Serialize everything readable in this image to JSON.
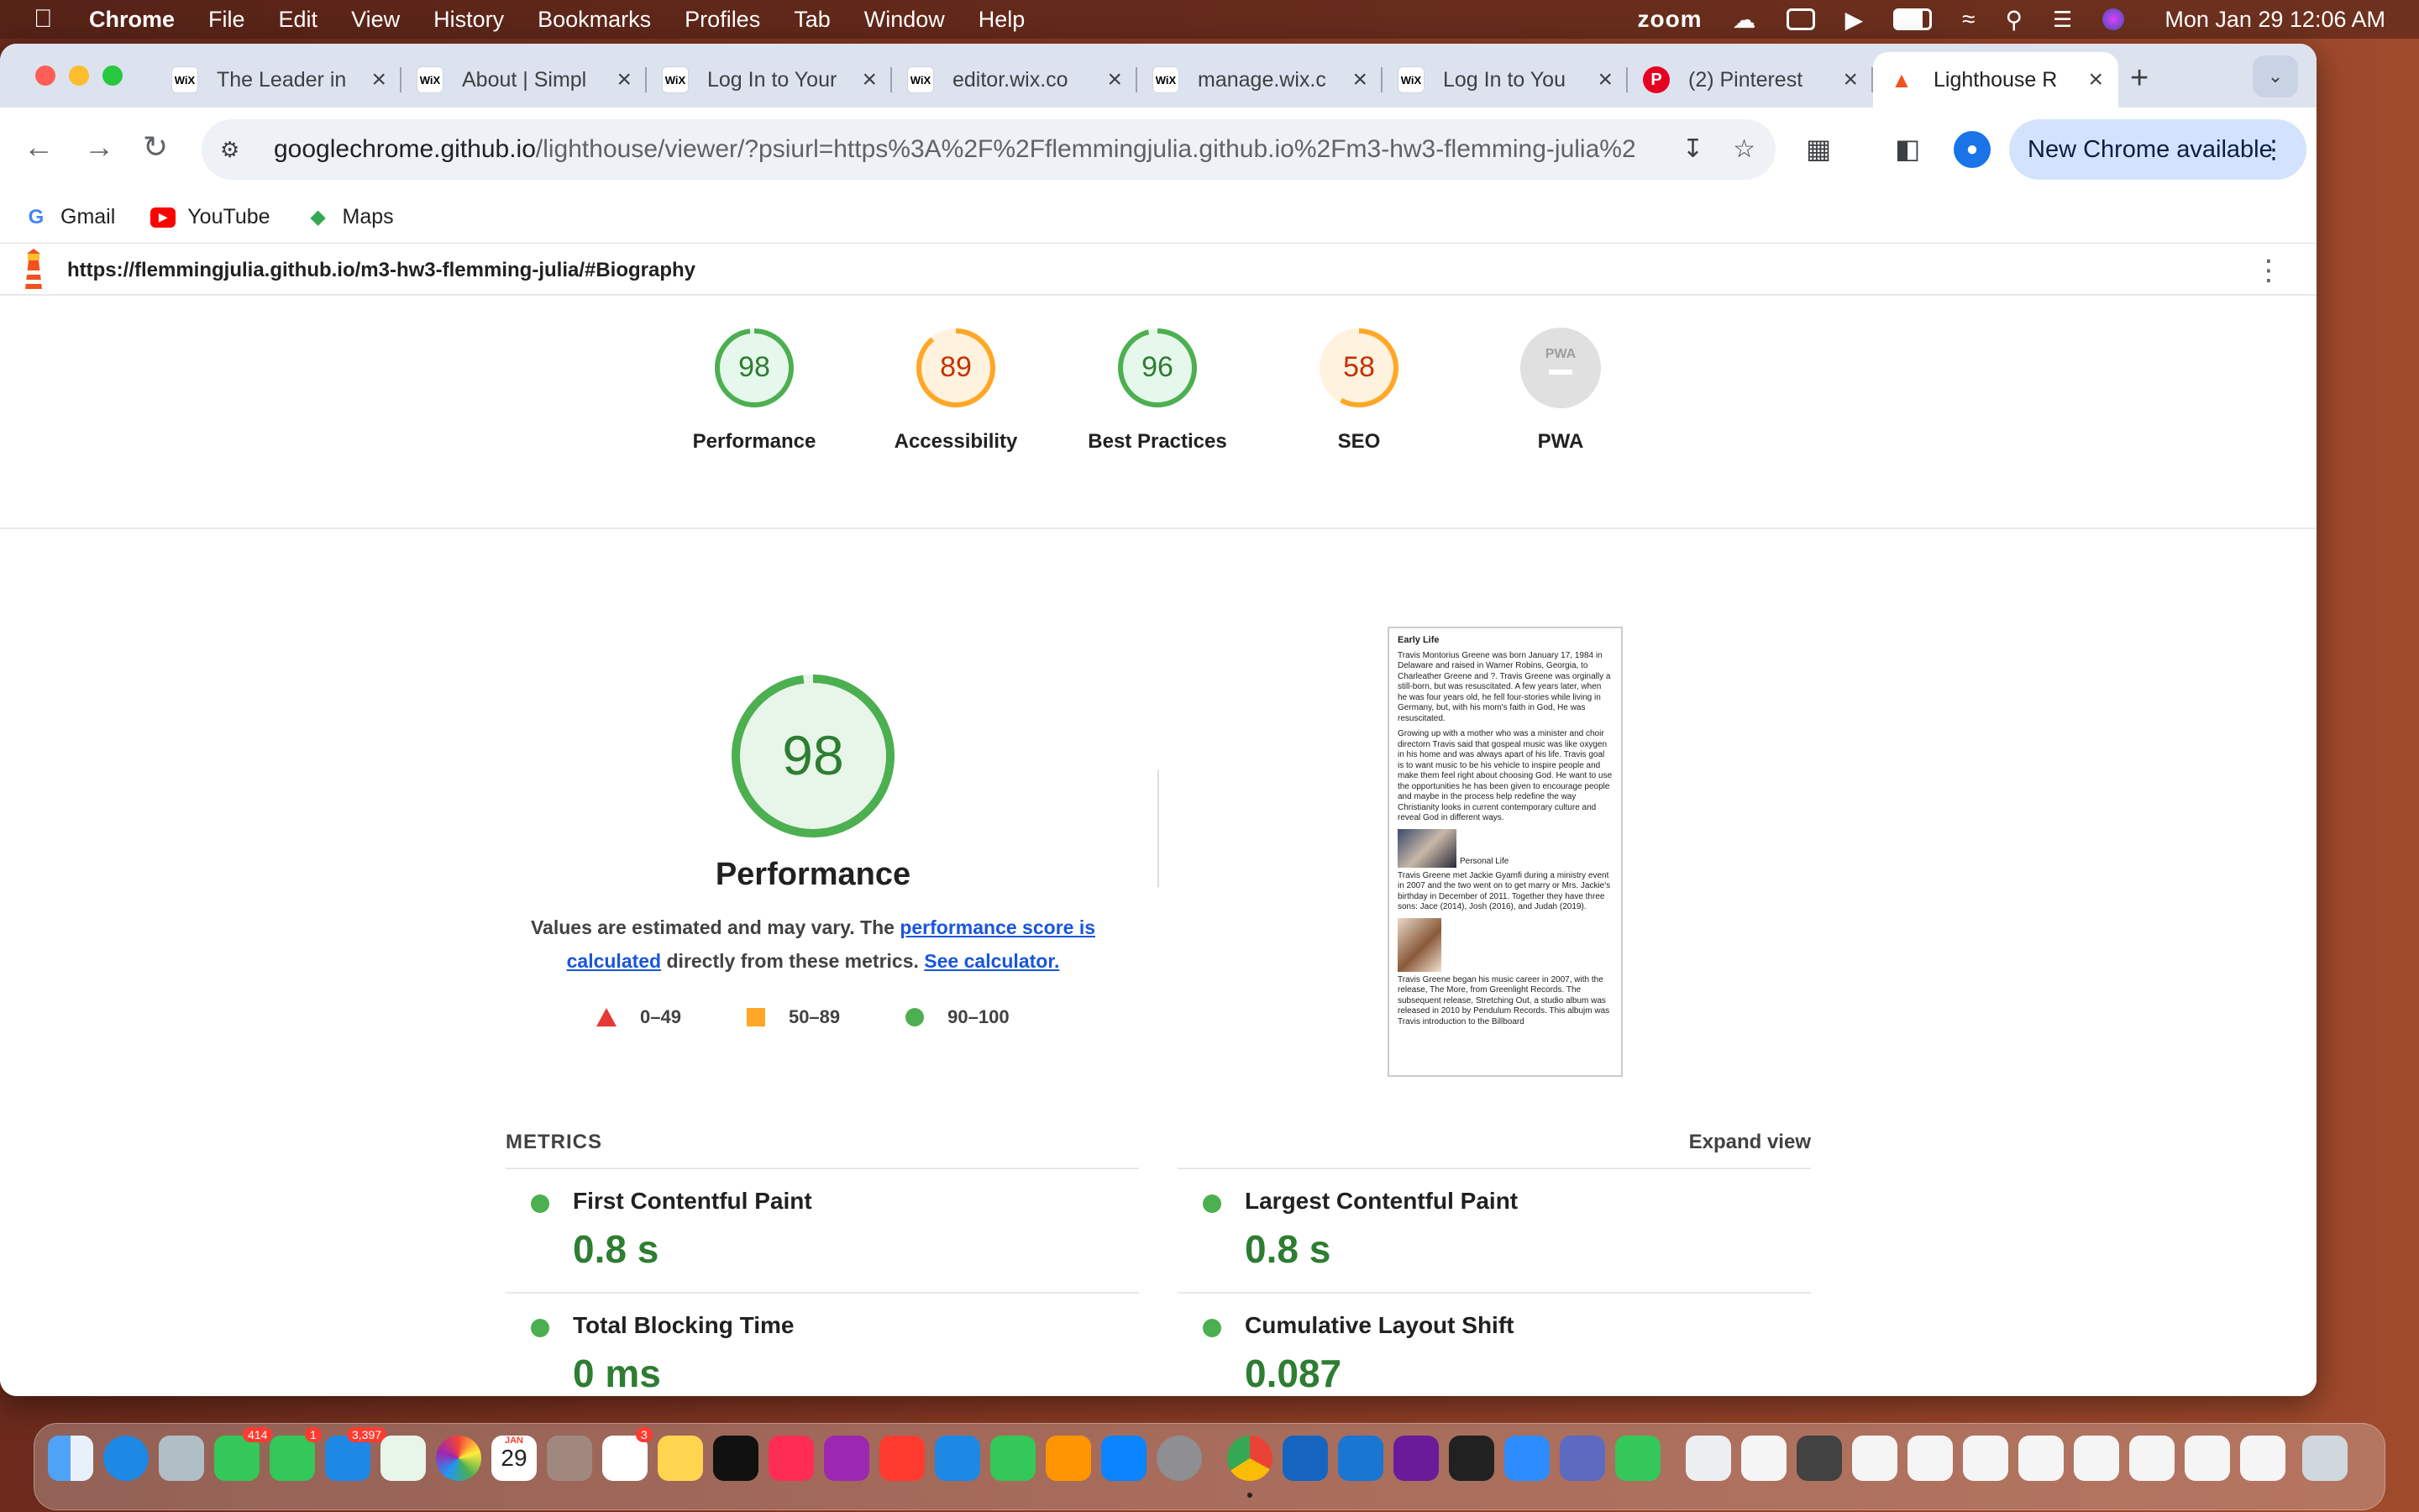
{
  "menubar": {
    "app": "Chrome",
    "items": [
      "File",
      "Edit",
      "View",
      "History",
      "Bookmarks",
      "Profiles",
      "Tab",
      "Window",
      "Help"
    ],
    "zoom": "zoom",
    "clock": "Mon Jan 29  12:06 AM"
  },
  "tabs": [
    {
      "title": "The Leader in",
      "icon": "wix"
    },
    {
      "title": "About | Simpl",
      "icon": "wix"
    },
    {
      "title": "Log In to Your",
      "icon": "wix"
    },
    {
      "title": "editor.wix.co",
      "icon": "wix"
    },
    {
      "title": "manage.wix.c",
      "icon": "wix"
    },
    {
      "title": "Log In to You",
      "icon": "wix"
    },
    {
      "title": "(2) Pinterest",
      "icon": "pinterest"
    },
    {
      "title": "Lighthouse R",
      "icon": "lighthouse"
    }
  ],
  "toolbar": {
    "url_host": "googlechrome.github.io",
    "url_rest": "/lighthouse/viewer/?psiurl=https%3A%2F%2Fflemmingjulia.github.io%2Fm3-hw3-flemming-julia%2...",
    "new_chrome": "New Chrome available"
  },
  "bookmarks": [
    {
      "label": "Gmail",
      "icon": "google-icon"
    },
    {
      "label": "YouTube",
      "icon": "youtube-icon"
    },
    {
      "label": "Maps",
      "icon": "maps-icon"
    }
  ],
  "lighthouse": {
    "report_url": "https://flemmingjulia.github.io/m3-hw3-flemming-julia/#Biography",
    "gauges": [
      {
        "label": "Performance",
        "score": "98",
        "value": 98,
        "color": "#0cce6b"
      },
      {
        "label": "Accessibility",
        "score": "89",
        "value": 89,
        "color": "#ffa400"
      },
      {
        "label": "Best Practices",
        "score": "96",
        "value": 96,
        "color": "#0cce6b"
      },
      {
        "label": "SEO",
        "score": "58",
        "value": 58,
        "color": "#ffa400"
      },
      {
        "label": "PWA",
        "score": "PWA",
        "value": 0,
        "color": "#9e9e9e"
      }
    ],
    "performance": {
      "score": "98",
      "value": 98,
      "title": "Performance",
      "desc_1": "Values are estimated and may vary. The ",
      "desc_link1": "performance score is calculated",
      "desc_2": " directly from these metrics. ",
      "desc_link2": "See calculator."
    },
    "legend": [
      "0–49",
      "50–89",
      "90–100"
    ],
    "thumbnail": {
      "heading": "Early Life",
      "p1": "Travis Montorius Greene was born January 17, 1984 in Delaware and raised in Warner Robins, Georgia, to Charleather Greene and ?. Travis Greene was orginally a still-born, but was resuscitated. A few years later, when he was four years old, he fell four-stories while living in Germany, but, with his mom's faith in God, He was resuscitated.",
      "p2": "Growing up with a mother who was a minister and choir directorn Travis said that gospeal music was like oxygen in his home and was always apart of his life. Travis goal is to want music to be his vehicle to inspire people and make them feel right about choosing God. He want to use the opportunities he has been given to encourage people and maybe in the process help redefine the way Christianity looks in current contemporary culture and reveal God in different ways.",
      "caption": "Personal Life",
      "p3": "Travis Greene met Jackie Gyamfi during a ministry event in 2007 and the two went on to get marry or Mrs. Jackie's birthday in December of 2011. Together they have three sons: Jace (2014), Josh (2016), and Judah (2019).",
      "p4": "Travis Greene began his music career in 2007, with the release, The More, from Greenlight Records. The subsequent release, Stretching Out, a studio album was released in 2010 by Pendulum Records. This albujm was Travis introduction to the Billboard"
    },
    "metrics_title": "METRICS",
    "expand": "Expand view",
    "metrics": [
      {
        "name": "First Contentful Paint",
        "value": "0.8 s"
      },
      {
        "name": "Largest Contentful Paint",
        "value": "0.8 s"
      },
      {
        "name": "Total Blocking Time",
        "value": "0 ms"
      },
      {
        "name": "Cumulative Layout Shift",
        "value": "0.087"
      }
    ]
  },
  "dock": {
    "badges": [
      "414",
      "1",
      "3,397",
      "3"
    ],
    "calendar_month": "JAN",
    "calendar_day": "29"
  }
}
